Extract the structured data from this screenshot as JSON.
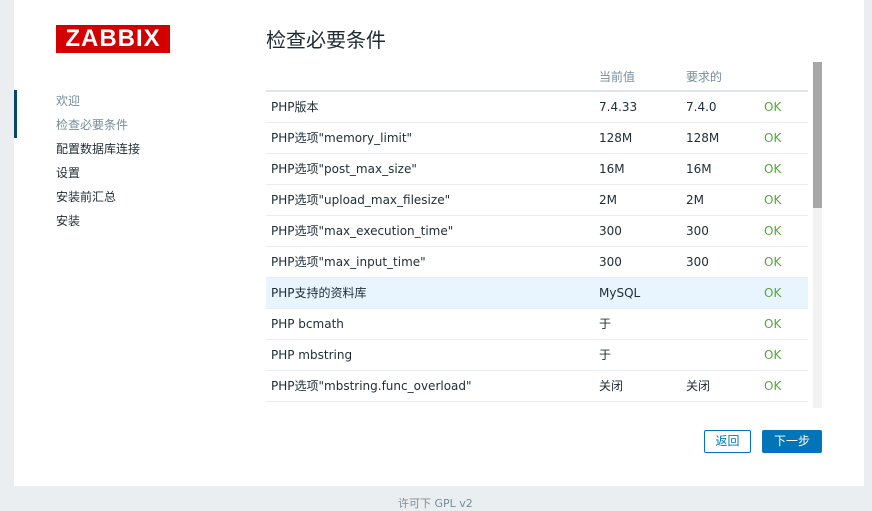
{
  "logo": "ZABBIX",
  "steps": [
    {
      "label": "欢迎",
      "state": "done"
    },
    {
      "label": "检查必要条件",
      "state": "current"
    },
    {
      "label": "配置数据库连接",
      "state": "todo"
    },
    {
      "label": "设置",
      "state": "todo"
    },
    {
      "label": "安装前汇总",
      "state": "todo"
    },
    {
      "label": "安装",
      "state": "todo"
    }
  ],
  "title": "检查必要条件",
  "table": {
    "headers": [
      "",
      "当前值",
      "要求的",
      ""
    ],
    "rows": [
      {
        "name": "PHP版本",
        "current": "7.4.33",
        "required": "7.4.0",
        "result": "OK"
      },
      {
        "name": "PHP选项\"memory_limit\"",
        "current": "128M",
        "required": "128M",
        "result": "OK"
      },
      {
        "name": "PHP选项\"post_max_size\"",
        "current": "16M",
        "required": "16M",
        "result": "OK"
      },
      {
        "name": "PHP选项\"upload_max_filesize\"",
        "current": "2M",
        "required": "2M",
        "result": "OK"
      },
      {
        "name": "PHP选项\"max_execution_time\"",
        "current": "300",
        "required": "300",
        "result": "OK"
      },
      {
        "name": "PHP选项\"max_input_time\"",
        "current": "300",
        "required": "300",
        "result": "OK"
      },
      {
        "name": "PHP支持的资料库",
        "current": "MySQL",
        "required": "",
        "result": "OK",
        "highlighted": true
      },
      {
        "name": "PHP bcmath",
        "current": "于",
        "required": "",
        "result": "OK"
      },
      {
        "name": "PHP mbstring",
        "current": "于",
        "required": "",
        "result": "OK"
      },
      {
        "name": "PHP选项\"mbstring.func_overload\"",
        "current": "关闭",
        "required": "关闭",
        "result": "OK"
      }
    ]
  },
  "buttons": {
    "back": "返回",
    "next": "下一步"
  },
  "footer": "许可下 GPL v2"
}
